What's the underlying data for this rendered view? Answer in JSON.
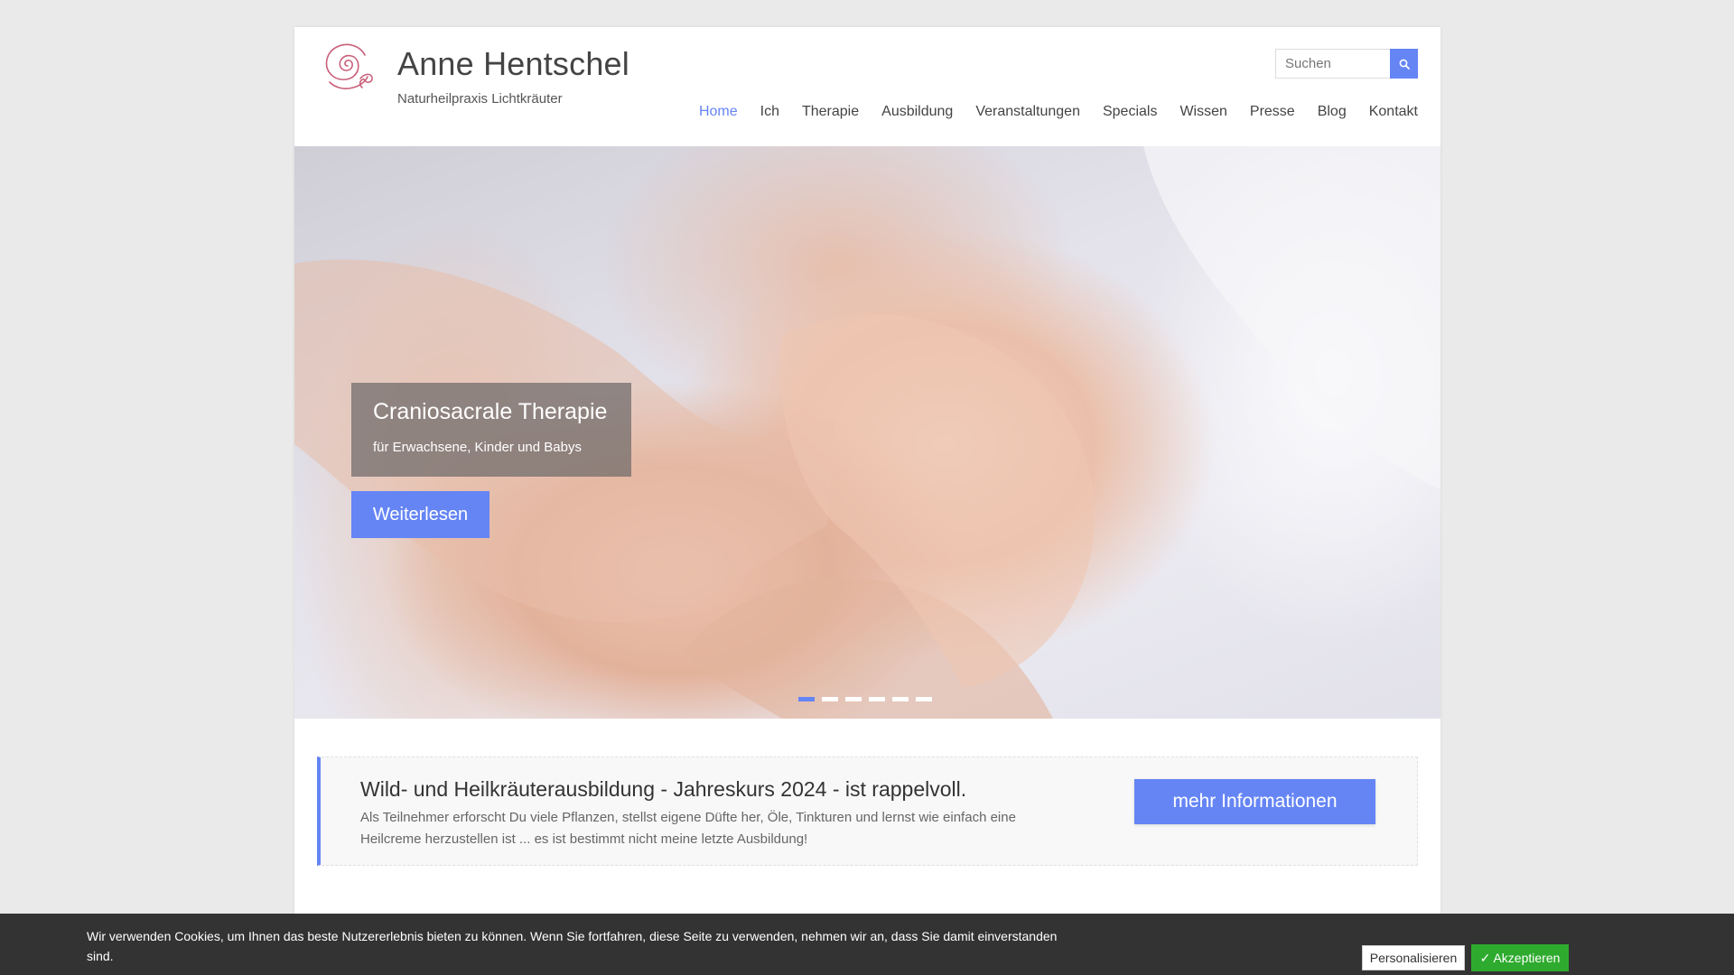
{
  "header": {
    "site_title": "Anne Hentschel",
    "tagline": "Naturheilpraxis Lichtkräuter",
    "search_placeholder": "Suchen"
  },
  "nav": {
    "items": [
      {
        "label": "Home",
        "active": true
      },
      {
        "label": "Ich"
      },
      {
        "label": "Therapie"
      },
      {
        "label": "Ausbildung"
      },
      {
        "label": "Veranstaltungen"
      },
      {
        "label": "Specials"
      },
      {
        "label": "Wissen"
      },
      {
        "label": "Presse"
      },
      {
        "label": "Blog"
      },
      {
        "label": "Kontakt"
      }
    ]
  },
  "slider": {
    "caption_title": "Craniosacrale Therapie",
    "caption_subtitle": "für Erwachsene, Kinder und Babys",
    "button_label": "Weiterlesen",
    "slide_count": 6,
    "active_slide": 1
  },
  "promo": {
    "title": "Wild- und Heilkräuterausbildung - Jahreskurs 2024 - ist rappelvoll.",
    "text": "Als Teilnehmer erforscht Du viele Pflanzen, stellst eigene Düfte her, Öle, Tinkturen und lernst wie einfach eine Heilcreme herzustellen ist ... es ist bestimmt nicht meine letzte Ausbildung!",
    "button_label": "mehr Informationen"
  },
  "cookie": {
    "text": "Wir verwenden Cookies, um Ihnen das beste Nutzererlebnis bieten zu können. Wenn Sie fortfahren, diese Seite zu verwenden, nehmen wir an, dass Sie damit einverstanden sind.",
    "personalize_label": "Personalisieren",
    "accept_label": "✓ Akzeptieren"
  },
  "colors": {
    "accent": "#6585f5",
    "accept_green": "#2eab2e",
    "cookie_bg": "#333333",
    "logo": "#c9607a"
  },
  "icons": {
    "logo": "spiral-heart-logo",
    "search": "search-icon"
  }
}
